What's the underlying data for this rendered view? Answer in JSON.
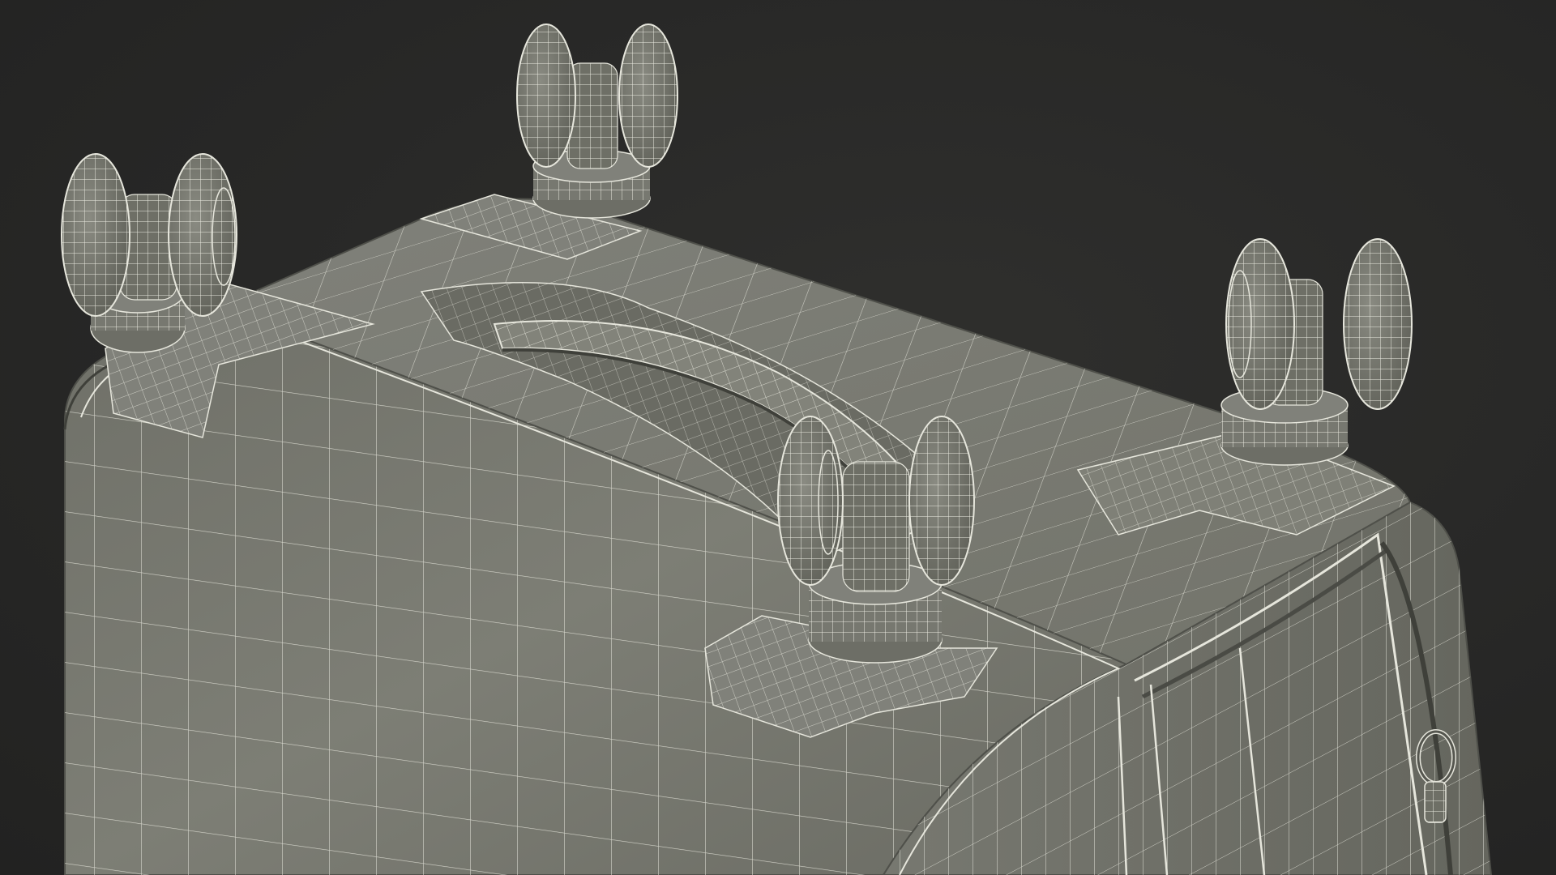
{
  "scene": {
    "background_color": "#2a2a29",
    "model_fill_color": "#7b7c72",
    "model_shadow_color": "#5a5b53",
    "model_highlight_color": "#8e8f85",
    "wire_color": "#e6e6dc",
    "subject": "suitcase-wireframe-mesh",
    "wheel_count": 4
  }
}
